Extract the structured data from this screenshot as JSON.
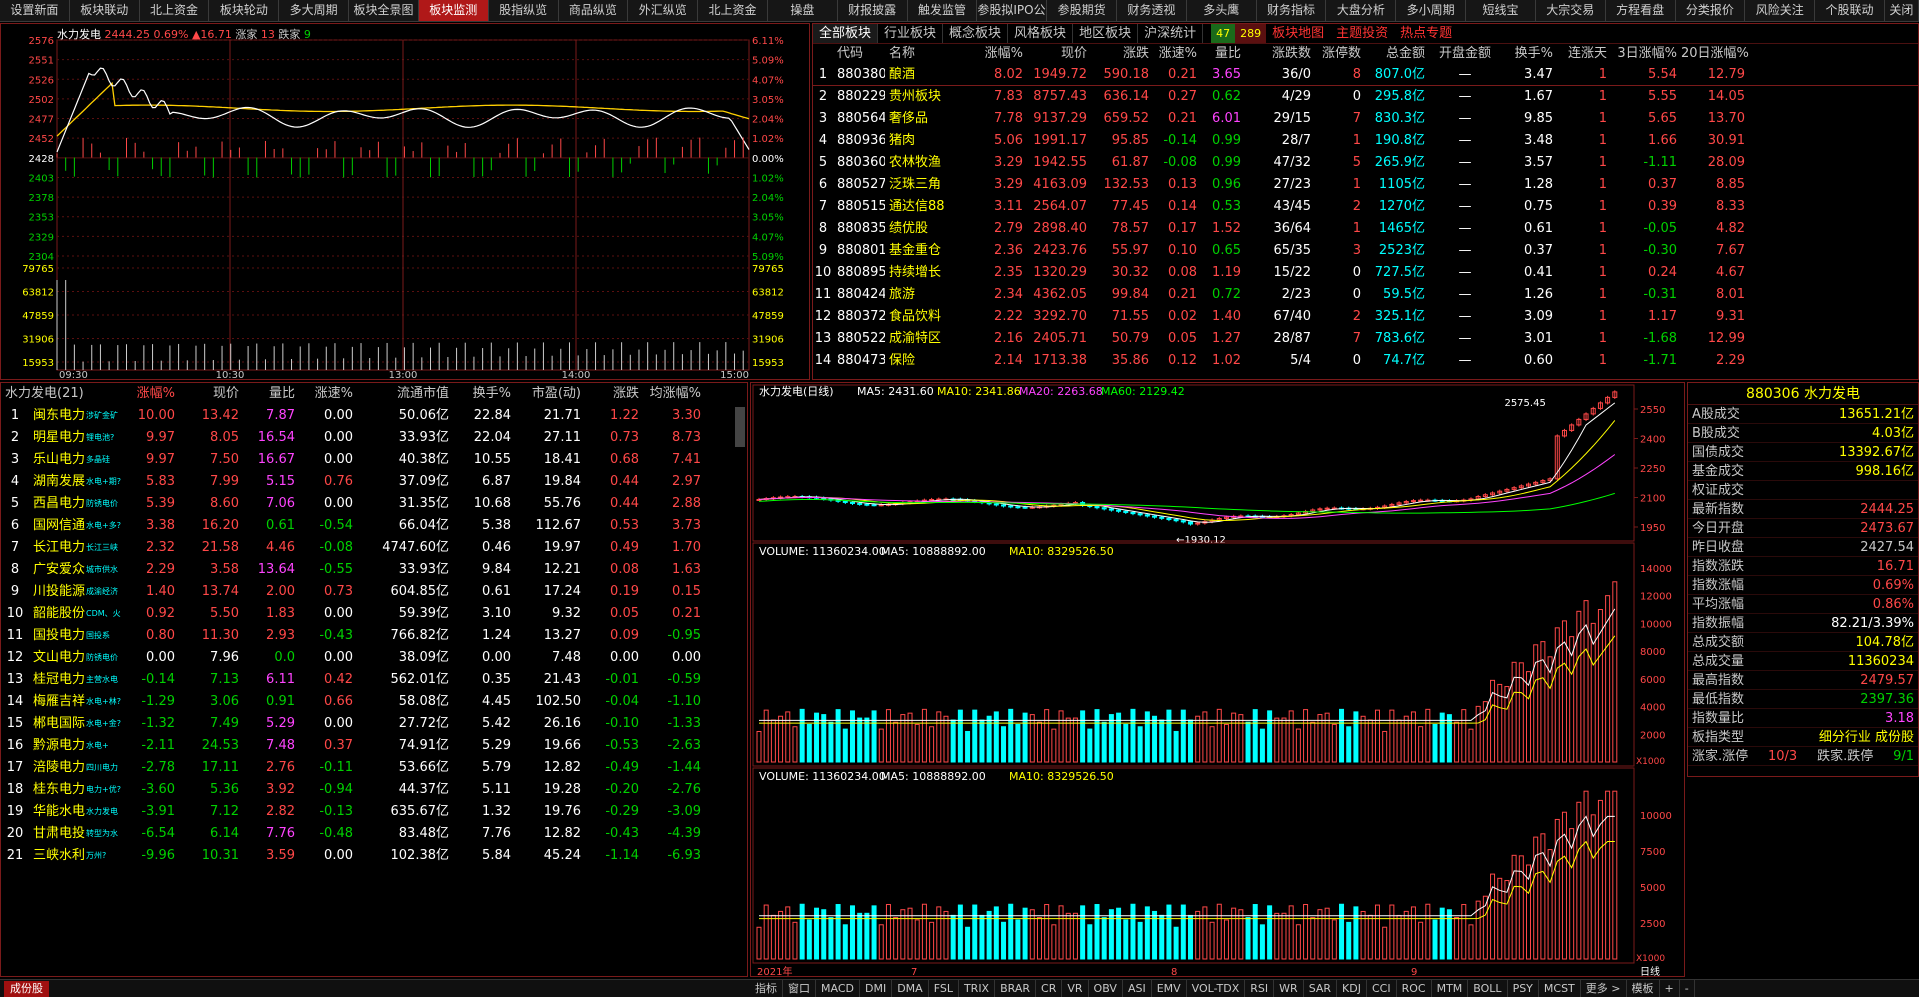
{
  "tabs": [
    "设置新面",
    "板块联动",
    "北上资金",
    "板块轮动",
    "多大周期",
    "板块全景图",
    "板块监测",
    "股指纵览",
    "商品纵览",
    "外汇纵览",
    "北上资金",
    "操盘",
    "财报披露",
    "触发监管",
    "参股拟IPO公司",
    "参股期货",
    "财务透视",
    "多头鹰",
    "财务指标",
    "大盘分析",
    "多小周期",
    "短线宝",
    "大宗交易",
    "方程看盘",
    "分类报价",
    "风险关注",
    "个股联动",
    "关闭"
  ],
  "active_tab": "板块监测",
  "intraday": {
    "title": "水力发电",
    "price": "2444.25",
    "pct": "0.69%",
    "chg": "▲16.71",
    "up_label": "涨家",
    "up_count": "13",
    "down_label": "跌家",
    "down_count": "9",
    "price_ticks": [
      "2576",
      "2551",
      "2526",
      "2502",
      "2477",
      "2452",
      "2428",
      "2403",
      "2378",
      "2353",
      "2329",
      "2304"
    ],
    "pct_ticks": [
      "6.11%",
      "5.09%",
      "4.07%",
      "3.05%",
      "2.04%",
      "1.02%",
      "0.00%",
      "1.02%",
      "2.04%",
      "3.05%",
      "4.07%",
      "5.09%"
    ],
    "vol_ticks": [
      "79765",
      "63812",
      "47859",
      "31906",
      "15953"
    ],
    "times": [
      "09:30",
      "10:30",
      "13:00",
      "14:00",
      "15:00"
    ]
  },
  "board_tabs": [
    "全部板块",
    "行业板块",
    "概念板块",
    "风格板块",
    "地区板块",
    "沪深统计"
  ],
  "board_counts": [
    "47",
    "289"
  ],
  "board_links": [
    "板块地图",
    "主题投资",
    "热点专题"
  ],
  "board_headers": [
    "",
    "代码",
    "名称",
    "涨幅%",
    "现价",
    "涨跌",
    "涨速%",
    "量比",
    "涨跌数",
    "涨停数",
    "总金额",
    "开盘金额",
    "换手%",
    "连涨天",
    "3日涨幅%",
    "20日涨幅%"
  ],
  "boards": [
    [
      "1",
      "880380",
      "酿酒",
      "8.02",
      "1949.72",
      "590.18",
      "0.21",
      "3.65",
      "36/0",
      "8",
      "807.0亿",
      "—",
      "3.47",
      "1",
      "5.54",
      "12.79"
    ],
    [
      "2",
      "880229",
      "贵州板块",
      "7.83",
      "8757.43",
      "636.14",
      "0.27",
      "0.62",
      "4/29",
      "0",
      "295.8亿",
      "—",
      "1.67",
      "1",
      "5.55",
      "14.05"
    ],
    [
      "3",
      "880564",
      "奢侈品",
      "7.78",
      "9137.29",
      "659.52",
      "0.21",
      "6.01",
      "29/15",
      "7",
      "830.3亿",
      "—",
      "9.85",
      "1",
      "5.65",
      "13.70"
    ],
    [
      "4",
      "880936",
      "猪肉",
      "5.06",
      "1991.17",
      "95.85",
      "-0.14",
      "0.99",
      "28/7",
      "1",
      "190.8亿",
      "—",
      "3.48",
      "1",
      "1.66",
      "30.91"
    ],
    [
      "5",
      "880360",
      "农林牧渔",
      "3.29",
      "1942.55",
      "61.87",
      "-0.08",
      "0.99",
      "47/32",
      "5",
      "265.9亿",
      "—",
      "3.57",
      "1",
      "-1.11",
      "28.09"
    ],
    [
      "6",
      "880527",
      "泛珠三角",
      "3.29",
      "4163.09",
      "132.53",
      "0.13",
      "0.96",
      "27/23",
      "1",
      "1105亿",
      "—",
      "1.28",
      "1",
      "0.37",
      "8.85"
    ],
    [
      "7",
      "880515",
      "通达信88",
      "3.11",
      "2564.07",
      "77.45",
      "0.14",
      "0.53",
      "43/45",
      "2",
      "1270亿",
      "—",
      "0.75",
      "1",
      "0.39",
      "8.33"
    ],
    [
      "8",
      "880835",
      "绩优股",
      "2.79",
      "2898.40",
      "78.57",
      "0.17",
      "1.52",
      "36/64",
      "1",
      "1465亿",
      "—",
      "0.61",
      "1",
      "-0.05",
      "4.82"
    ],
    [
      "9",
      "880801",
      "基金重仓",
      "2.36",
      "2423.76",
      "55.97",
      "0.10",
      "0.65",
      "65/35",
      "3",
      "2523亿",
      "—",
      "0.37",
      "1",
      "-0.30",
      "7.67"
    ],
    [
      "10",
      "880895",
      "持续增长",
      "2.35",
      "1320.29",
      "30.32",
      "0.08",
      "1.19",
      "15/22",
      "0",
      "727.5亿",
      "—",
      "0.41",
      "1",
      "0.24",
      "4.67"
    ],
    [
      "11",
      "880424",
      "旅游",
      "2.34",
      "4362.05",
      "99.84",
      "0.21",
      "0.72",
      "2/23",
      "0",
      "59.5亿",
      "—",
      "1.26",
      "1",
      "-0.31",
      "8.01"
    ],
    [
      "12",
      "880372",
      "食品饮料",
      "2.22",
      "3292.70",
      "71.55",
      "0.02",
      "1.40",
      "67/40",
      "2",
      "325.1亿",
      "—",
      "3.09",
      "1",
      "1.17",
      "9.31"
    ],
    [
      "13",
      "880522",
      "成渝特区",
      "2.16",
      "2405.71",
      "50.79",
      "0.05",
      "1.27",
      "28/87",
      "7",
      "783.6亿",
      "—",
      "3.01",
      "1",
      "-1.68",
      "12.99"
    ],
    [
      "14",
      "880473",
      "保险",
      "2.14",
      "1713.38",
      "35.86",
      "0.12",
      "1.02",
      "5/4",
      "0",
      "74.7亿",
      "—",
      "0.60",
      "1",
      "-1.71",
      "2.29"
    ]
  ],
  "list_headers": [
    "水力发电(21)",
    "涨幅%",
    "现价",
    "量比",
    "涨速%",
    "流通市值",
    "换手%",
    "市盈(动)",
    "涨跌",
    "均涨幅%"
  ],
  "stocks": [
    [
      "1",
      "闽东电力",
      "涉矿金矿",
      "10.00",
      "13.42",
      "7.87",
      "0.00",
      "50.06亿",
      "22.84",
      "21.71",
      "1.22",
      "3.30"
    ],
    [
      "2",
      "明星电力",
      "锂电池?",
      "9.97",
      "8.05",
      "16.54",
      "0.00",
      "33.93亿",
      "22.04",
      "27.11",
      "0.73",
      "8.73"
    ],
    [
      "3",
      "乐山电力",
      "多晶硅",
      "9.97",
      "7.50",
      "16.67",
      "0.00",
      "40.38亿",
      "10.55",
      "18.41",
      "0.68",
      "7.41"
    ],
    [
      "4",
      "湖南发展",
      "水电+期?",
      "5.83",
      "7.99",
      "5.15",
      "0.76",
      "37.09亿",
      "6.87",
      "19.84",
      "0.44",
      "2.97"
    ],
    [
      "5",
      "西昌电力",
      "防锈电价",
      "5.39",
      "8.60",
      "7.06",
      "0.00",
      "31.35亿",
      "10.68",
      "55.76",
      "0.44",
      "2.88"
    ],
    [
      "6",
      "国网信通",
      "水电+多?",
      "3.38",
      "16.20",
      "0.61",
      "-0.54",
      "66.04亿",
      "5.38",
      "112.67",
      "0.53",
      "3.73"
    ],
    [
      "7",
      "长江电力",
      "长江三峡",
      "2.32",
      "21.58",
      "4.46",
      "-0.08",
      "4747.60亿",
      "0.46",
      "19.97",
      "0.49",
      "1.70"
    ],
    [
      "8",
      "广安爱众",
      "城市供水",
      "2.29",
      "3.58",
      "13.64",
      "-0.55",
      "33.93亿",
      "9.84",
      "12.21",
      "0.08",
      "1.63"
    ],
    [
      "9",
      "川投能源",
      "成渝经济",
      "1.40",
      "13.74",
      "2.00",
      "0.73",
      "604.85亿",
      "0.61",
      "17.24",
      "0.19",
      "0.15"
    ],
    [
      "10",
      "韶能股份",
      "CDM、火?",
      "0.92",
      "5.50",
      "1.83",
      "0.00",
      "59.39亿",
      "3.10",
      "9.32",
      "0.05",
      "0.21"
    ],
    [
      "11",
      "国投电力",
      "国投系",
      "0.80",
      "11.30",
      "2.93",
      "-0.43",
      "766.82亿",
      "1.24",
      "13.27",
      "0.09",
      "-0.95"
    ],
    [
      "12",
      "文山电力",
      "防锈电价",
      "0.00",
      "7.96",
      "0.0",
      "0.00",
      "38.09亿",
      "0.00",
      "7.48",
      "0.00",
      "0.00"
    ],
    [
      "13",
      "桂冠电力",
      "主营水电",
      "-0.14",
      "7.13",
      "6.11",
      "0.42",
      "562.01亿",
      "0.35",
      "21.43",
      "-0.01",
      "-0.59"
    ],
    [
      "14",
      "梅雁吉祥",
      "水电+林?",
      "-1.29",
      "3.06",
      "0.91",
      "0.66",
      "58.08亿",
      "4.45",
      "102.50",
      "-0.04",
      "-1.10"
    ],
    [
      "15",
      "郴电国际",
      "水电+金?",
      "-1.32",
      "7.49",
      "5.29",
      "0.00",
      "27.72亿",
      "5.42",
      "26.16",
      "-0.10",
      "-1.33"
    ],
    [
      "16",
      "黔源电力",
      "水电+",
      "-2.11",
      "24.53",
      "7.48",
      "0.37",
      "74.91亿",
      "5.29",
      "19.66",
      "-0.53",
      "-2.63"
    ],
    [
      "17",
      "涪陵电力",
      "四川电力",
      "-2.78",
      "17.11",
      "2.76",
      "-0.11",
      "53.66亿",
      "5.79",
      "12.82",
      "-0.49",
      "-1.44"
    ],
    [
      "18",
      "桂东电力",
      "电力+优?",
      "-3.60",
      "5.36",
      "3.92",
      "-0.94",
      "44.37亿",
      "5.11",
      "19.28",
      "-0.20",
      "-2.76"
    ],
    [
      "19",
      "华能水电",
      "水力发电",
      "-3.91",
      "7.12",
      "2.82",
      "-0.13",
      "635.67亿",
      "1.32",
      "19.76",
      "-0.29",
      "-3.09"
    ],
    [
      "20",
      "甘肃电投",
      "转型为水",
      "-6.54",
      "6.14",
      "7.76",
      "-0.48",
      "83.48亿",
      "7.76",
      "12.82",
      "-0.43",
      "-4.39"
    ],
    [
      "21",
      "三峡水利",
      "万州?",
      "-9.96",
      "10.31",
      "3.59",
      "0.00",
      "102.38亿",
      "5.84",
      "45.24",
      "-1.14",
      "-6.93"
    ]
  ],
  "daily": {
    "title": "水力发电(日线)",
    "ma5": "MA5: 2431.60",
    "ma10": "MA10: 2341.86",
    "ma20": "MA20: 2263.68",
    "ma60": "MA60: 2129.42",
    "hi": "2575.45",
    "lo": "1930.12",
    "ticks": [
      "2550",
      "2400",
      "2250",
      "2100",
      "1950"
    ]
  },
  "vol1": {
    "title": "VOLUME: 11360234.00",
    "ma5": "MA5: 10888892.00",
    "ma10": "MA10: 8329526.50",
    "ticks": [
      "14000",
      "12000",
      "10000",
      "8000",
      "6000",
      "4000",
      "2000"
    ],
    "unit": "X1000"
  },
  "vol2": {
    "title": "VOLUME: 11360234.00",
    "ma5": "MA5: 10888892.00",
    "ma10": "MA10: 8329526.50",
    "ticks": [
      "10000",
      "7500",
      "5000",
      "2500"
    ],
    "unit": "X1000"
  },
  "xlabels": [
    "2021年",
    "7",
    "8",
    "9"
  ],
  "period": "日线",
  "info": {
    "title": "880306 水力发电",
    "rows": [
      [
        "A股成交",
        "13651.21亿",
        "yel"
      ],
      [
        "B股成交",
        "4.03亿",
        "yel"
      ],
      [
        "国债成交",
        "13392.67亿",
        "yel"
      ],
      [
        "基金成交",
        "998.16亿",
        "yel"
      ],
      [
        "权证成交",
        "",
        ""
      ],
      [
        "最新指数",
        "2444.25",
        "red"
      ],
      [
        "今日开盘",
        "2473.67",
        "red"
      ],
      [
        "昨日收盘",
        "2427.54",
        "gry"
      ],
      [
        "指数涨跌",
        "16.71",
        "red"
      ],
      [
        "指数涨幅",
        "0.69%",
        "red"
      ],
      [
        "平均涨幅",
        "0.86%",
        "red"
      ],
      [
        "指数振幅",
        "82.21/3.39%",
        "wht"
      ],
      [
        "总成交额",
        "104.78亿",
        "yel"
      ],
      [
        "总成交量",
        "11360234",
        "yel"
      ],
      [
        "最高指数",
        "2479.57",
        "red"
      ],
      [
        "最低指数",
        "2397.36",
        "grn"
      ],
      [
        "指数量比",
        "3.18",
        "mag"
      ]
    ],
    "type_label": "板指类型",
    "type_value": "细分行业 成份股",
    "rf_label1": "涨家.涨停",
    "rf_val1": "10/3",
    "rf_label2": "跌家.跌停",
    "rf_val2": "9/1"
  },
  "indicators": [
    "指标",
    "窗口",
    "MACD",
    "DMI",
    "DMA",
    "FSL",
    "TRIX",
    "BRAR",
    "CR",
    "VR",
    "OBV",
    "ASI",
    "EMV",
    "VOL-TDX",
    "RSI",
    "WR",
    "SAR",
    "KDJ",
    "CCI",
    "ROC",
    "MTM",
    "BOLL",
    "PSY",
    "MCST",
    "更多 >",
    "模板",
    "+",
    "-"
  ],
  "bottom_tab": "成份股"
}
